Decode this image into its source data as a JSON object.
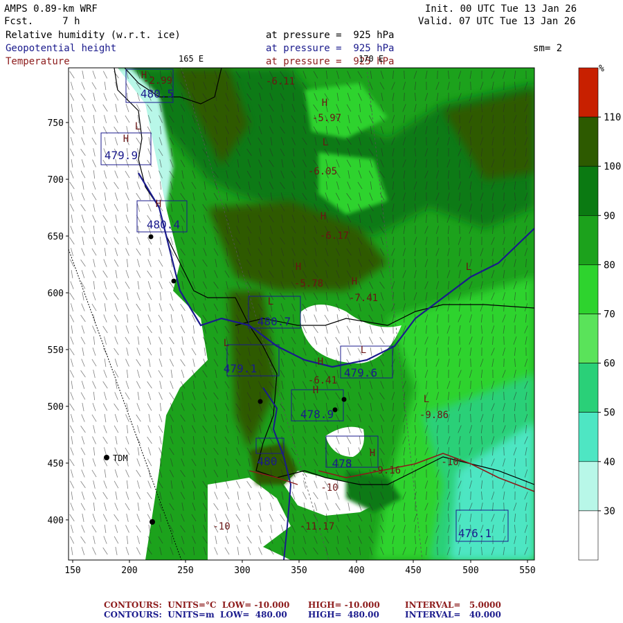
{
  "header": {
    "model": "AMPS 0.89-km WRF",
    "fcst": "Fcst.     7 h",
    "init": "Init. 00 UTC Tue 13 Jan 26",
    "valid": "Valid. 07 UTC Tue 13 Jan 26",
    "field_rh": "Relative humidity (w.r.t. ice)",
    "field_gph": "Geopotential height",
    "field_temp": "Temperature",
    "pressure_1": "at pressure =  925 hPa",
    "pressure_2": "at pressure =  925 hPa",
    "pressure_3": "at pressure =  925 hPa",
    "sm": "sm= 2",
    "lon_165": "165 E",
    "lon_170": "170 E"
  },
  "map": {
    "x_ticks": [
      "150",
      "200",
      "250",
      "300",
      "350",
      "400",
      "450",
      "500",
      "550"
    ],
    "y_ticks": [
      "750",
      "700",
      "650",
      "600",
      "550",
      "500",
      "450",
      "400"
    ],
    "station": "TDM",
    "height_labels": [
      "480.5",
      "479.9",
      "480.4",
      "480.7",
      "479.1",
      "479.6",
      "478.9",
      "480",
      "478",
      "476.1"
    ],
    "temp_labels": [
      "-2.99",
      "-6.11",
      "-5.97",
      "-6.05",
      "-6.17",
      "-5.78",
      "-7.41",
      "-6.41",
      "-9.86",
      "-9.16",
      "-10",
      "-10",
      "-11.17",
      "-10"
    ],
    "hl_markers": [
      "H",
      "L",
      "H",
      "H",
      "H",
      "L",
      "H",
      "H",
      "L",
      "H",
      "L",
      "L",
      "H",
      "L",
      "H",
      "L",
      "H"
    ]
  },
  "colorbar": {
    "unit": "%",
    "labels": [
      "110",
      "100",
      "90",
      "80",
      "70",
      "60",
      "50",
      "40",
      "30"
    ],
    "colors": [
      "#c82000",
      "#2d5a00",
      "#0b7a12",
      "#1ca21c",
      "#2ed32e",
      "#5ae35a",
      "#2ad078",
      "#4ee6c3",
      "#b8f7e8",
      "#ffffff"
    ]
  },
  "footer": {
    "line1_a": "CONTOURS:  UNITS=°C  LOW= -10.000",
    "line1_b": "HIGH= -10.000",
    "line1_c": "INTERVAL=   5.0000",
    "line2_a": "CONTOURS:  UNITS=m  LOW=  480.00",
    "line2_b": "HIGH=  480.00",
    "line2_c": "INTERVAL=   40.000"
  }
}
